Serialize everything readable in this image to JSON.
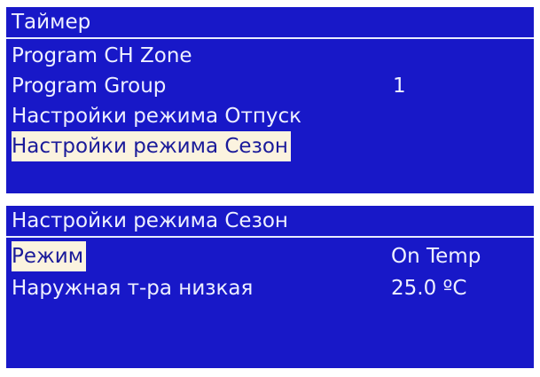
{
  "timer_menu": {
    "title": "Таймер",
    "items": [
      {
        "label": "Program CH Zone",
        "value": ""
      },
      {
        "label": "Program Group",
        "value": "1"
      },
      {
        "label": "Настройки режима Отпуск",
        "value": ""
      },
      {
        "label": "Настройки режима Сезон",
        "value": ""
      }
    ],
    "selected_index": 3
  },
  "season_menu": {
    "title": "Настройки режима Сезон",
    "items": [
      {
        "label": "Режим",
        "value": "On Temp"
      },
      {
        "label": "Наружная т-ра низкая",
        "value": "25.0 ºC"
      }
    ],
    "selected_index": 0
  },
  "colors": {
    "lcd_background": "#1818c8",
    "text": "#eef0ff",
    "selection_background": "#fbf3df",
    "selection_text": "#1a1a9a"
  }
}
